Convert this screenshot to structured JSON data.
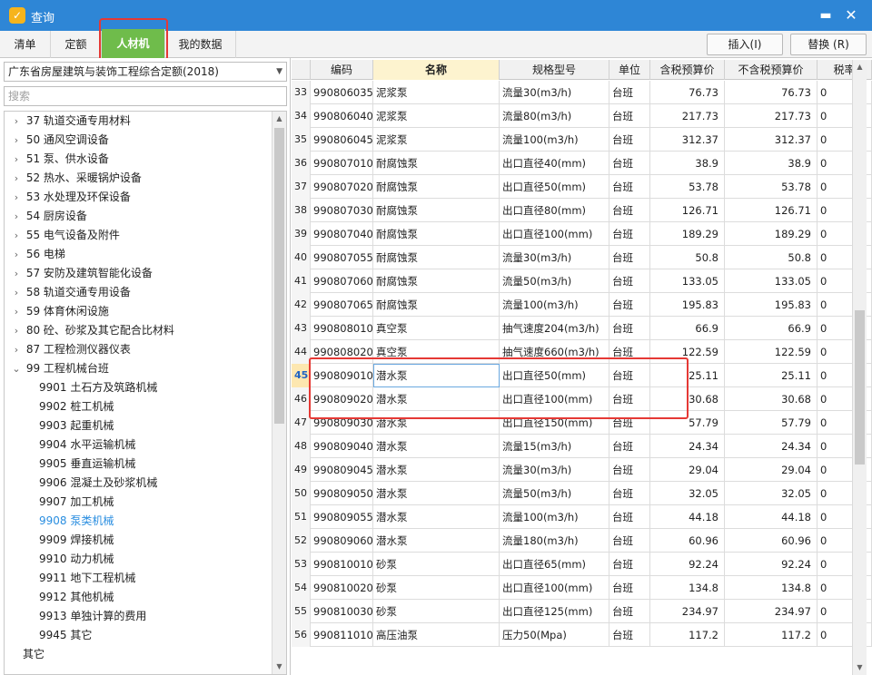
{
  "window": {
    "title": "查询",
    "minimize_glyph": "▬",
    "close_glyph": "✕",
    "icon_glyph": "✓"
  },
  "tabs": [
    {
      "label": "清单",
      "active": false
    },
    {
      "label": "定额",
      "active": false
    },
    {
      "label": "人材机",
      "active": true
    },
    {
      "label": "我的数据",
      "active": false
    }
  ],
  "actions": {
    "insert_label": "插入(I)",
    "replace_label": "替换 (R)"
  },
  "left_panel": {
    "quota_library": "广东省房屋建筑与装饰工程综合定额(2018)",
    "search_placeholder": "搜索",
    "tree": [
      {
        "label": "37 轨道交通专用材料",
        "level": 0,
        "toggle": "›"
      },
      {
        "label": "50 通风空调设备",
        "level": 0,
        "toggle": "›"
      },
      {
        "label": "51 泵、供水设备",
        "level": 0,
        "toggle": "›"
      },
      {
        "label": "52 热水、采暖锅炉设备",
        "level": 0,
        "toggle": "›"
      },
      {
        "label": "53 水处理及环保设备",
        "level": 0,
        "toggle": "›"
      },
      {
        "label": "54 厨房设备",
        "level": 0,
        "toggle": "›"
      },
      {
        "label": "55 电气设备及附件",
        "level": 0,
        "toggle": "›"
      },
      {
        "label": "56 电梯",
        "level": 0,
        "toggle": "›"
      },
      {
        "label": "57 安防及建筑智能化设备",
        "level": 0,
        "toggle": "›"
      },
      {
        "label": "58 轨道交通专用设备",
        "level": 0,
        "toggle": "›"
      },
      {
        "label": "59 体育休闲设施",
        "level": 0,
        "toggle": "›"
      },
      {
        "label": "80 砼、砂浆及其它配合比材料",
        "level": 0,
        "toggle": "›"
      },
      {
        "label": "87 工程检测仪器仪表",
        "level": 0,
        "toggle": "›"
      },
      {
        "label": "99 工程机械台班",
        "level": 0,
        "toggle": "⌄"
      },
      {
        "label": "9901 土石方及筑路机械",
        "level": 1,
        "toggle": ""
      },
      {
        "label": "9902 桩工机械",
        "level": 1,
        "toggle": ""
      },
      {
        "label": "9903 起重机械",
        "level": 1,
        "toggle": ""
      },
      {
        "label": "9904 水平运输机械",
        "level": 1,
        "toggle": ""
      },
      {
        "label": "9905 垂直运输机械",
        "level": 1,
        "toggle": ""
      },
      {
        "label": "9906 混凝土及砂浆机械",
        "level": 1,
        "toggle": ""
      },
      {
        "label": "9907 加工机械",
        "level": 1,
        "toggle": ""
      },
      {
        "label": "9908 泵类机械",
        "level": 1,
        "toggle": "",
        "selected": true
      },
      {
        "label": "9909 焊接机械",
        "level": 1,
        "toggle": ""
      },
      {
        "label": "9910 动力机械",
        "level": 1,
        "toggle": ""
      },
      {
        "label": "9911 地下工程机械",
        "level": 1,
        "toggle": ""
      },
      {
        "label": "9912 其他机械",
        "level": 1,
        "toggle": ""
      },
      {
        "label": "9913 单独计算的费用",
        "level": 1,
        "toggle": ""
      },
      {
        "label": "9945 其它",
        "level": 1,
        "toggle": ""
      },
      {
        "label": "其它",
        "level": -1,
        "toggle": ""
      }
    ]
  },
  "grid": {
    "columns": [
      "",
      "编码",
      "名称",
      "规格型号",
      "单位",
      "含税预算价",
      "不含税预算价",
      "税率"
    ],
    "active_column": 2,
    "current_row": "45",
    "rows": [
      [
        "33",
        "990806035",
        "泥浆泵",
        "流量30(m3/h)",
        "台班",
        "76.73",
        "76.73",
        "0"
      ],
      [
        "34",
        "990806040",
        "泥浆泵",
        "流量80(m3/h)",
        "台班",
        "217.73",
        "217.73",
        "0"
      ],
      [
        "35",
        "990806045",
        "泥浆泵",
        "流量100(m3/h)",
        "台班",
        "312.37",
        "312.37",
        "0"
      ],
      [
        "36",
        "990807010",
        "耐腐蚀泵",
        "出口直径40(mm)",
        "台班",
        "38.9",
        "38.9",
        "0"
      ],
      [
        "37",
        "990807020",
        "耐腐蚀泵",
        "出口直径50(mm)",
        "台班",
        "53.78",
        "53.78",
        "0"
      ],
      [
        "38",
        "990807030",
        "耐腐蚀泵",
        "出口直径80(mm)",
        "台班",
        "126.71",
        "126.71",
        "0"
      ],
      [
        "39",
        "990807040",
        "耐腐蚀泵",
        "出口直径100(mm)",
        "台班",
        "189.29",
        "189.29",
        "0"
      ],
      [
        "40",
        "990807055",
        "耐腐蚀泵",
        "流量30(m3/h)",
        "台班",
        "50.8",
        "50.8",
        "0"
      ],
      [
        "41",
        "990807060",
        "耐腐蚀泵",
        "流量50(m3/h)",
        "台班",
        "133.05",
        "133.05",
        "0"
      ],
      [
        "42",
        "990807065",
        "耐腐蚀泵",
        "流量100(m3/h)",
        "台班",
        "195.83",
        "195.83",
        "0"
      ],
      [
        "43",
        "990808010",
        "真空泵",
        "抽气速度204(m3/h)",
        "台班",
        "66.9",
        "66.9",
        "0"
      ],
      [
        "44",
        "990808020",
        "真空泵",
        "抽气速度660(m3/h)",
        "台班",
        "122.59",
        "122.59",
        "0"
      ],
      [
        "45",
        "990809010",
        "潜水泵",
        "出口直径50(mm)",
        "台班",
        "25.11",
        "25.11",
        "0"
      ],
      [
        "46",
        "990809020",
        "潜水泵",
        "出口直径100(mm)",
        "台班",
        "30.68",
        "30.68",
        "0"
      ],
      [
        "47",
        "990809030",
        "潜水泵",
        "出口直径150(mm)",
        "台班",
        "57.79",
        "57.79",
        "0"
      ],
      [
        "48",
        "990809040",
        "潜水泵",
        "流量15(m3/h)",
        "台班",
        "24.34",
        "24.34",
        "0"
      ],
      [
        "49",
        "990809045",
        "潜水泵",
        "流量30(m3/h)",
        "台班",
        "29.04",
        "29.04",
        "0"
      ],
      [
        "50",
        "990809050",
        "潜水泵",
        "流量50(m3/h)",
        "台班",
        "32.05",
        "32.05",
        "0"
      ],
      [
        "51",
        "990809055",
        "潜水泵",
        "流量100(m3/h)",
        "台班",
        "44.18",
        "44.18",
        "0"
      ],
      [
        "52",
        "990809060",
        "潜水泵",
        "流量180(m3/h)",
        "台班",
        "60.96",
        "60.96",
        "0"
      ],
      [
        "53",
        "990810010",
        "砂泵",
        "出口直径65(mm)",
        "台班",
        "92.24",
        "92.24",
        "0"
      ],
      [
        "54",
        "990810020",
        "砂泵",
        "出口直径100(mm)",
        "台班",
        "134.8",
        "134.8",
        "0"
      ],
      [
        "55",
        "990810030",
        "砂泵",
        "出口直径125(mm)",
        "台班",
        "234.97",
        "234.97",
        "0"
      ],
      [
        "56",
        "990811010",
        "高压油泵",
        "压力50(Mpa)",
        "台班",
        "117.2",
        "117.2",
        "0"
      ]
    ]
  },
  "scroll_arrows": {
    "up": "▲",
    "down": "▼"
  },
  "colors": {
    "titlebar": "#2e86d6",
    "active_tab": "#6fbc4b",
    "highlight_box": "#e53935",
    "selected_tree_item": "#2a8ee0"
  }
}
